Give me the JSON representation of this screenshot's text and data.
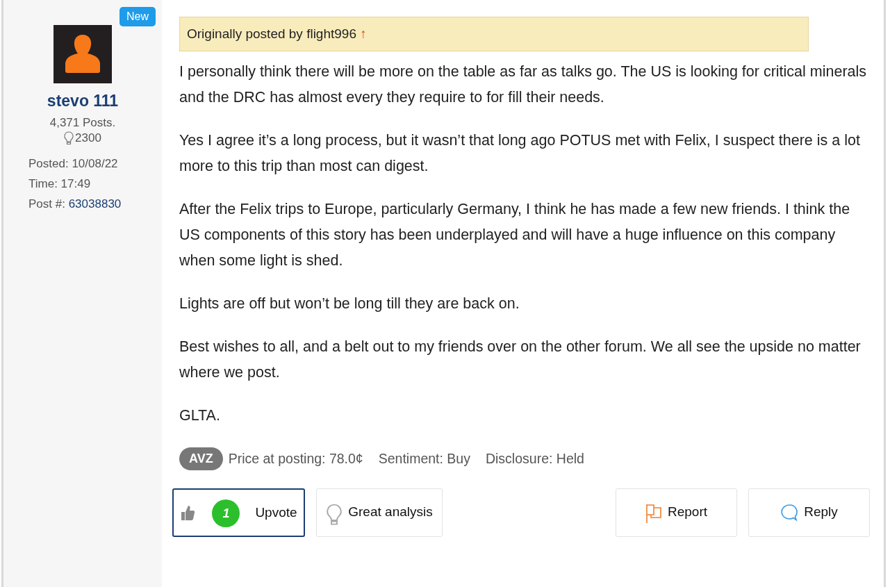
{
  "author": {
    "badge": "New",
    "name": "stevo 111",
    "posts": "4,371 Posts.",
    "likes": "2300",
    "posted_label": "Posted:",
    "posted": "10/08/22",
    "time_label": "Time:",
    "time": "17:49",
    "post_no_label": "Post #:",
    "post_no": "63038830"
  },
  "quote": {
    "text": "Originally posted by flight996",
    "arrow": "↑"
  },
  "paragraphs": [
    "I personally think there will be more on the table as far as talks go. The US is looking for critical minerals and the DRC has almost every they require to for fill their needs.",
    "Yes I agree it’s a long process, but it wasn’t that long ago POTUS met with Felix, I suspect there is a lot more to this trip than most can digest.",
    "After the Felix trips to Europe, particularly Germany, I think he has made a few new friends. I think the US components of this story has been underplayed and will have a huge influence on this company when some light is shed.",
    "Lights are off but won’t be long till they are back on.",
    "Best wishes to all, and a belt out to my friends over on the other forum. We all see the upside no matter where we post.",
    "GLTA."
  ],
  "meta": {
    "ticker": "AVZ",
    "price": "Price at posting: 78.0¢",
    "sentiment": "Sentiment: Buy",
    "disclosure": "Disclosure: Held"
  },
  "actions": [
    {
      "kind": "upvote",
      "label": "Upvote",
      "count": "1",
      "selected": true
    },
    {
      "kind": "analysis",
      "label": "Great analysis",
      "selected": false
    },
    {
      "kind": "report",
      "label": "Report",
      "selected": false
    },
    {
      "kind": "reply",
      "label": "Reply",
      "selected": false
    }
  ]
}
